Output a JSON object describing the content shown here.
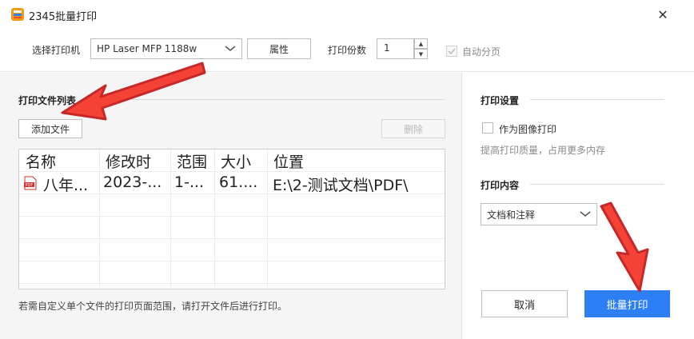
{
  "window": {
    "title": "2345批量打印",
    "close_symbol": "✕",
    "app_icon": "printer-app-icon"
  },
  "toolbar": {
    "printer_label": "选择打印机",
    "printer_value": "HP Laser MFP 1188w",
    "properties_label": "属性",
    "copies_label": "打印份数",
    "copies_value": "1",
    "collate_label": "自动分页",
    "collate_checked": true,
    "collate_disabled": true
  },
  "file_list": {
    "section_title": "打印文件列表",
    "add_button": "添加文件",
    "delete_button": "删除",
    "columns": [
      "名称",
      "修改时",
      "范围",
      "大小",
      "位置"
    ],
    "rows": [
      {
        "icon": "pdf-file-icon",
        "name": "八年...",
        "modified": "2023-...",
        "range": "1-...",
        "size": "61....",
        "location": "E:\\2-测试文档\\PDF\\"
      }
    ],
    "hint": "若需自定义单个文件的打印页面范围，请打开文件后进行打印。"
  },
  "settings": {
    "section_title": "打印设置",
    "as_image_label": "作为图像打印",
    "as_image_checked": false,
    "as_image_hint": "提高打印质量，占用更多内存",
    "content_title": "打印内容",
    "content_value": "文档和注释"
  },
  "actions": {
    "cancel": "取消",
    "batch_print": "批量打印"
  },
  "colors": {
    "accent": "#2d7ff5",
    "arrow": "#e53935"
  }
}
